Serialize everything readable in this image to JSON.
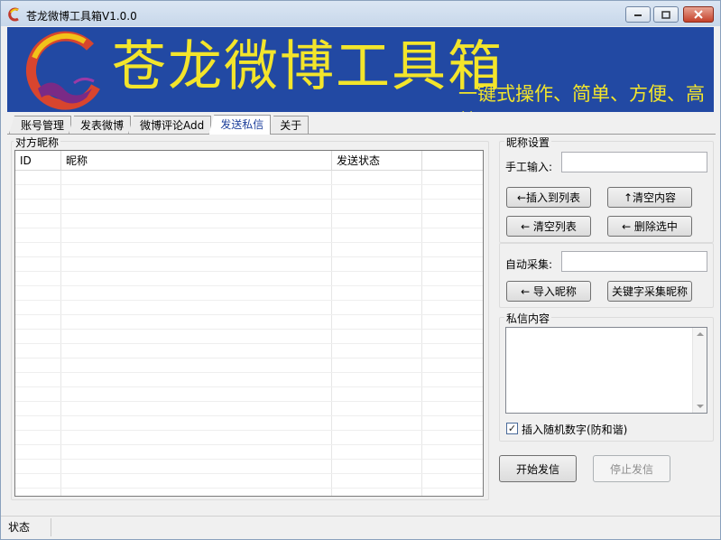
{
  "window": {
    "title": "苍龙微博工具箱V1.0.0"
  },
  "banner": {
    "title": "苍龙微博工具箱",
    "slogan": "一键式操作、简单、方便、高效"
  },
  "tabs": [
    {
      "label": "账号管理",
      "active": false
    },
    {
      "label": "发表微博",
      "active": false
    },
    {
      "label": "微博评论Add",
      "active": false
    },
    {
      "label": "发送私信",
      "active": true
    },
    {
      "label": "关于",
      "active": false
    }
  ],
  "target_group": {
    "label": "对方昵称",
    "columns": [
      "ID",
      "昵称",
      "发送状态",
      ""
    ],
    "rows": []
  },
  "nickname_settings": {
    "label": "昵称设置",
    "manual_input_label": "手工输入:",
    "manual_input_value": "",
    "insert_button": "←插入到列表",
    "clear_content_button": "↑清空内容",
    "clear_list_button": "←  清空列表",
    "delete_selected_button": "←  删除选中",
    "auto_collect_label": "自动采集:",
    "auto_collect_value": "",
    "import_button": "←  导入昵称",
    "keyword_collect_button": "关键字采集昵称"
  },
  "message": {
    "label": "私信内容",
    "content": "",
    "random_digits_checked": true,
    "random_digits_label": "插入随机数字(防和谐)"
  },
  "actions": {
    "start_button": "开始发信",
    "stop_button": "停止发信",
    "stop_disabled": true
  },
  "statusbar": {
    "text": "状态"
  },
  "colors": {
    "banner_bg": "#2249a3",
    "banner_text": "#f3e52b",
    "active_tab_text": "#1d3f9c",
    "close_button": "#c4412a"
  }
}
